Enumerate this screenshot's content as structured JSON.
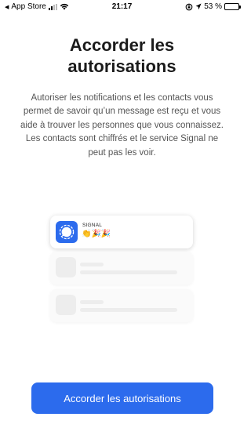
{
  "status_bar": {
    "back_app": "App Store",
    "time": "21:17",
    "battery_text": "53 %",
    "battery_level": 0.53
  },
  "screen": {
    "title": "Accorder les autorisations",
    "description": "Autoriser les notifications et les contacts vous permet de savoir qu’un message est reçu et vous aide à trouver les personnes que vous connaissez. Les contacts sont chiffrés et le service Signal ne peut pas les voir."
  },
  "illustration": {
    "notification": {
      "app_name": "SIGNAL",
      "emojis": "👏🎉🎉",
      "icon": "signal-app-icon"
    }
  },
  "actions": {
    "primary_label": "Accorder les autorisations"
  },
  "colors": {
    "accent": "#2c6bed",
    "text_primary": "#1b1b1b",
    "text_secondary": "#555555",
    "placeholder": "#ededed"
  }
}
